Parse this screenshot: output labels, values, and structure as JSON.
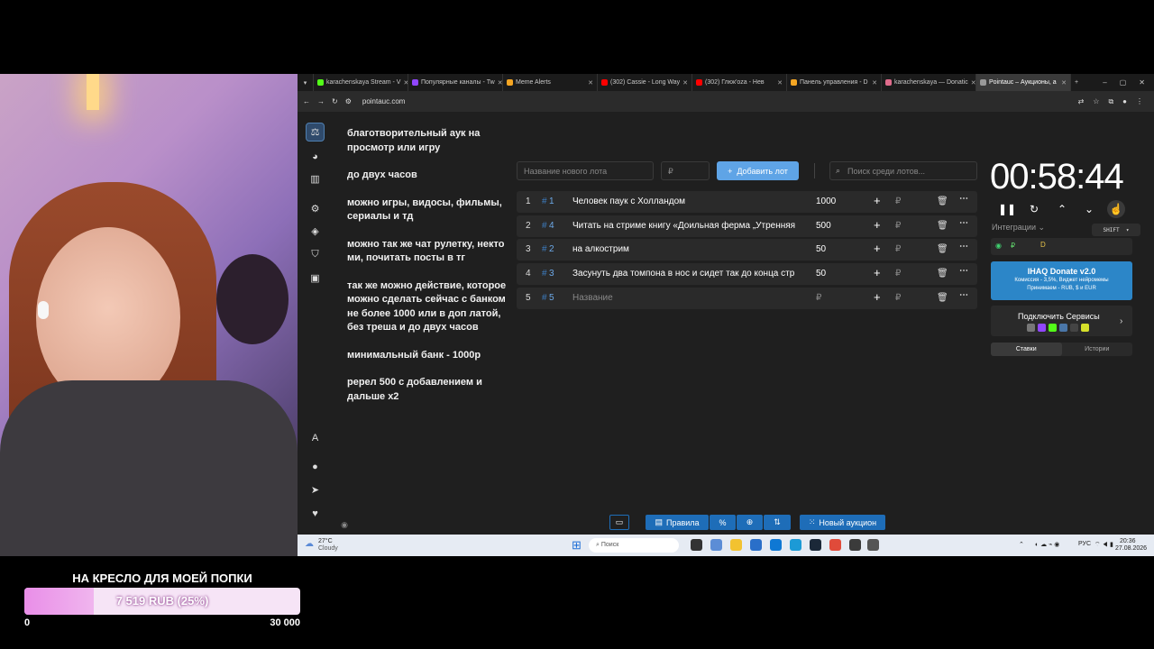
{
  "overlay": {
    "goal_title": "НА КРЕСЛО ДЛЯ МОЕЙ ПОПКИ",
    "goal_amount": "7 519 RUB (25%)",
    "goal_progress": 0.25,
    "goal_min": "0",
    "goal_max": "30 000"
  },
  "browser": {
    "tabs": [
      {
        "label": "karachenskaya Stream - V",
        "color": "#53fc18"
      },
      {
        "label": "Популярные каналы - Tw",
        "color": "#9146ff"
      },
      {
        "label": "Meme Alerts",
        "color": "#f5a623"
      },
      {
        "label": "(302) Cassie - Long Way",
        "color": "#ff0000"
      },
      {
        "label": "(302) Глюк'oza - Нев",
        "color": "#ff0000"
      },
      {
        "label": "Панель управления - D",
        "color": "#f5a623"
      },
      {
        "label": "karachenskaya — Donatic",
        "color": "#e06c8c"
      },
      {
        "label": "Pointauc – Аукционы, а",
        "color": "#999999"
      }
    ],
    "url": "pointauc.com"
  },
  "rules": [
    "благотворительный аук на просмотр или игру",
    "до  двух часов",
    "можно игры, видосы, фильмы, сериалы и тд",
    "можно так же чат рулетку, некто ми, почитать посты в тг",
    "так же можно действие, которое можно сделать сейчас с банком не более 1000 или в доп латой, без треша  и до двух часов",
    "минимальный банк - 1000р",
    "ререл 500 с добавлением и дальше х2"
  ],
  "form": {
    "lot_placeholder": "Название нового лота",
    "price_placeholder": "₽",
    "add_label": "Добавить лот",
    "search_placeholder": "Поиск среди лотов..."
  },
  "lots": [
    {
      "idx": "1",
      "hash": "1",
      "name": "Человек паук с Холландом",
      "amount": "1000"
    },
    {
      "idx": "2",
      "hash": "4",
      "name": "Читать на стриме книгу «Доильная ферма „Утренняя",
      "amount": "500"
    },
    {
      "idx": "3",
      "hash": "2",
      "name": "на алкострим",
      "amount": "50"
    },
    {
      "idx": "4",
      "hash": "3",
      "name": "Засунуть два томпона в нос и сидет так до конца стр",
      "amount": "50"
    },
    {
      "idx": "5",
      "hash": "5",
      "name": "Название",
      "amount": "₽"
    }
  ],
  "right": {
    "timer": "00:58:44",
    "integrations": "Интеграции",
    "shift": "SHIFT",
    "ihaq_title": "IHAQ Donate v2.0",
    "ihaq_line2": "Комиссия - 3,5%, Виджет нейромемы",
    "ihaq_line3": "Принимаем - RUB, $ и EUR",
    "connect": "Подключить Сервисы",
    "tab_bets": "Ставки",
    "tab_history": "Истории"
  },
  "toolbar": {
    "rules": "Правила",
    "percent": "%",
    "new_auction": "Новый аукцион"
  },
  "taskbar": {
    "temp": "27°C",
    "weather": "Cloudy",
    "search": "Поиск",
    "lang": "РУС",
    "time": "20:36",
    "date": "27.08.2026"
  }
}
